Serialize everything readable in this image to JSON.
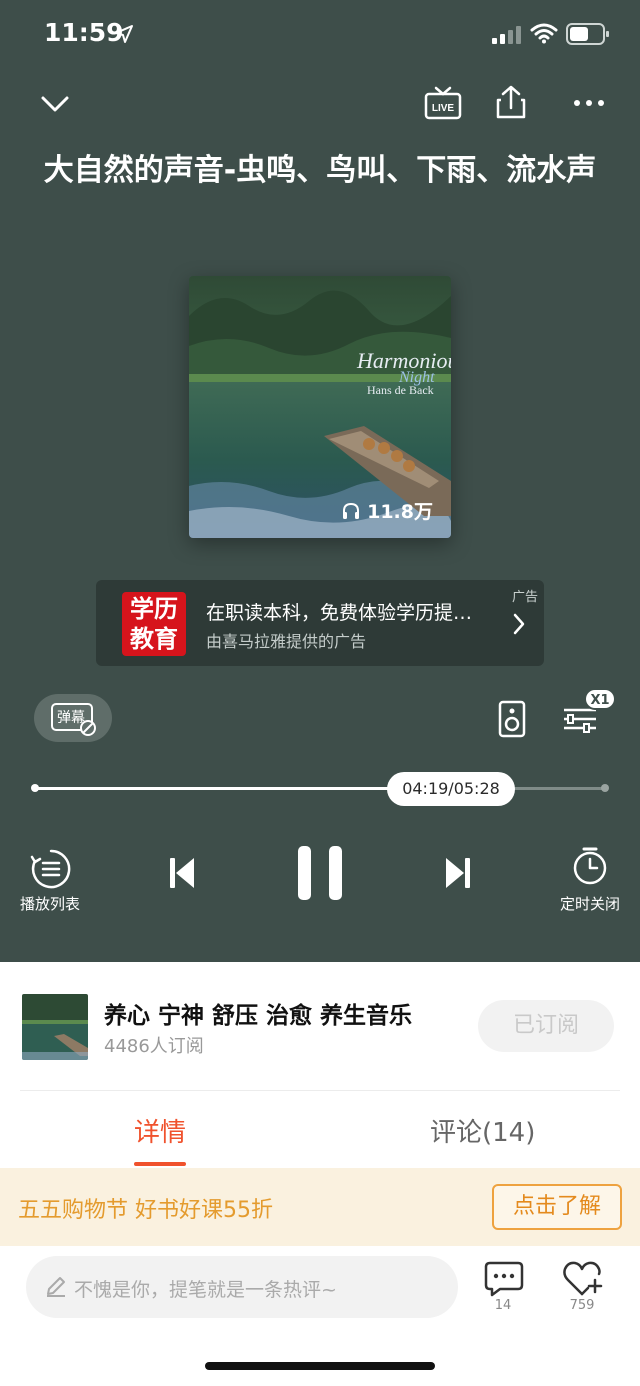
{
  "status_bar": {
    "time": "11:59"
  },
  "player": {
    "title": "大自然的声音-虫鸣、鸟叫、下雨、流水声",
    "cover": {
      "text_line1": "Harmonious",
      "text_line2": "Night",
      "artist": "Hans de Back"
    },
    "play_count": "11.8万",
    "live_badge": "LIVE",
    "ad": {
      "logo_line1": "学历",
      "logo_line2": "教育",
      "tag": "广告",
      "title": "在职读本科，免费体验学历提…",
      "subtitle": "由喜马拉雅提供的广告"
    },
    "danmu_label": "弹幕",
    "speed_label": "X1",
    "progress": {
      "time_text": "04:19/05:28",
      "fraction": 0.789
    },
    "controls": {
      "playlist_label": "播放列表",
      "timer_label": "定时关闭"
    }
  },
  "album": {
    "name": "养心 宁神 舒压 治愈 养生音乐",
    "subscribers": "4486人订阅",
    "subscribe_label": "已订阅"
  },
  "tabs": {
    "detail": "详情",
    "comments": "评论(14)"
  },
  "promo": {
    "text": "五五购物节 好书好课55折",
    "button": "点击了解"
  },
  "comment_bar": {
    "placeholder": "不愧是你，提笔就是一条热评~",
    "comment_count": "14",
    "like_count": "759"
  },
  "colors": {
    "player_bg": "#3e4e4a",
    "accent": "#f0522d",
    "promo_orange": "#e49b2e"
  },
  "icons": [
    "chevron-down-icon",
    "live-icon",
    "share-icon",
    "more-icon",
    "headphones-icon",
    "speaker-icon",
    "equalizer-icon",
    "playlist-icon",
    "previous-icon",
    "pause-icon",
    "next-icon",
    "timer-icon",
    "pencil-icon",
    "comment-icon",
    "heart-plus-icon"
  ]
}
